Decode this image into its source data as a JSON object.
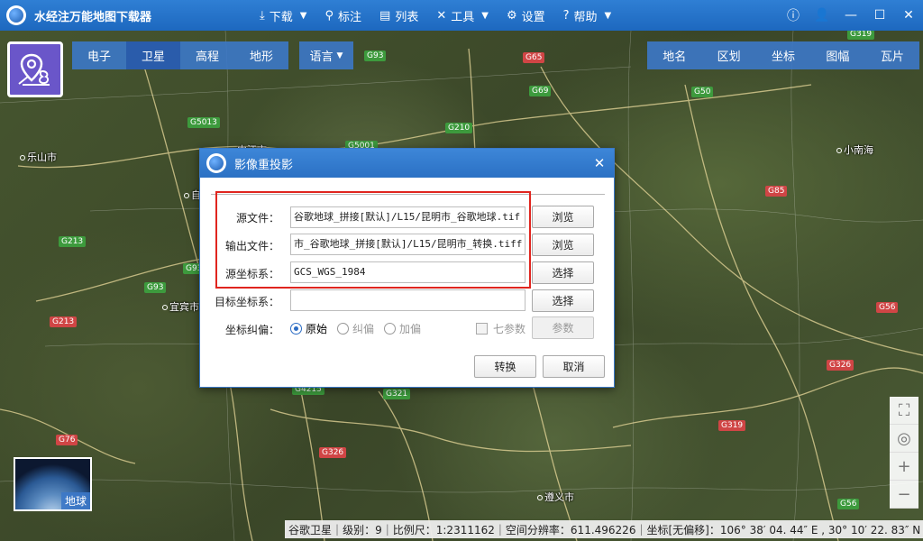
{
  "app": {
    "title": "水经注万能地图下载器",
    "menu": [
      {
        "icon": "⤓",
        "label": "下载",
        "caret": "▼"
      },
      {
        "icon": "⚲",
        "label": "标注",
        "caret": ""
      },
      {
        "icon": "▤",
        "label": "列表",
        "caret": ""
      },
      {
        "icon": "✕",
        "label": "工具",
        "caret": "▼"
      },
      {
        "icon": "⚙",
        "label": "设置",
        "caret": ""
      },
      {
        "icon": "?",
        "label": "帮助",
        "caret": "▼"
      }
    ],
    "window_controls": [
      "ⓘ",
      "👤",
      "—",
      "☐",
      "✕"
    ]
  },
  "map_types": {
    "tabs": [
      "电子",
      "卫星",
      "高程",
      "地形"
    ],
    "active": "卫星",
    "language": "语言"
  },
  "tools": [
    "地名",
    "区划",
    "坐标",
    "图幅",
    "瓦片"
  ],
  "zoom_controls": [
    "⛶",
    "◎",
    "+",
    "−"
  ],
  "globe": {
    "label": "地球"
  },
  "map_labels": {
    "places": [
      "乐山市",
      "宜宾市",
      "遵义市",
      "自",
      "内江市",
      "小南海"
    ],
    "roads": [
      "G93",
      "G76",
      "G5013",
      "G5001",
      "G210",
      "G65",
      "G69",
      "G50",
      "G319",
      "G85",
      "G93",
      "G213",
      "G213",
      "G76",
      "G4215",
      "G321",
      "G326",
      "G326",
      "G319",
      "G56",
      "G56",
      "G93"
    ]
  },
  "statusbar": {
    "layer": "谷歌卫星",
    "level": "级别：9",
    "scale": "比例尺：1:2311162",
    "resolution": "空间分辨率：611.496226",
    "coords": "坐标[无偏移]：106° 38′ 04. 44″ E , 30° 10′ 22. 83″ N"
  },
  "dialog": {
    "title": "影像重投影",
    "close": "✕",
    "fields": {
      "source_file": {
        "label": "源文件：",
        "value": "谷歌地球_拼接[默认]/L15/昆明市_谷歌地球.tif",
        "button": "浏览"
      },
      "output_file": {
        "label": "输出文件：",
        "value": "市_谷歌地球_拼接[默认]/L15/昆明市_转换.tiff",
        "button": "浏览"
      },
      "source_crs": {
        "label": "源坐标系：",
        "value": "GCS_WGS_1984",
        "button": "选择"
      },
      "target_crs": {
        "label": "目标坐标系：",
        "value": "",
        "button": "选择"
      }
    },
    "correction": {
      "label": "坐标纠偏：",
      "options": [
        "原始",
        "纠偏",
        "加偏"
      ],
      "selected": "原始",
      "seven_params_label": "七参数",
      "params_button": "参数"
    },
    "convert_button": "转换",
    "cancel_button": "取消"
  }
}
